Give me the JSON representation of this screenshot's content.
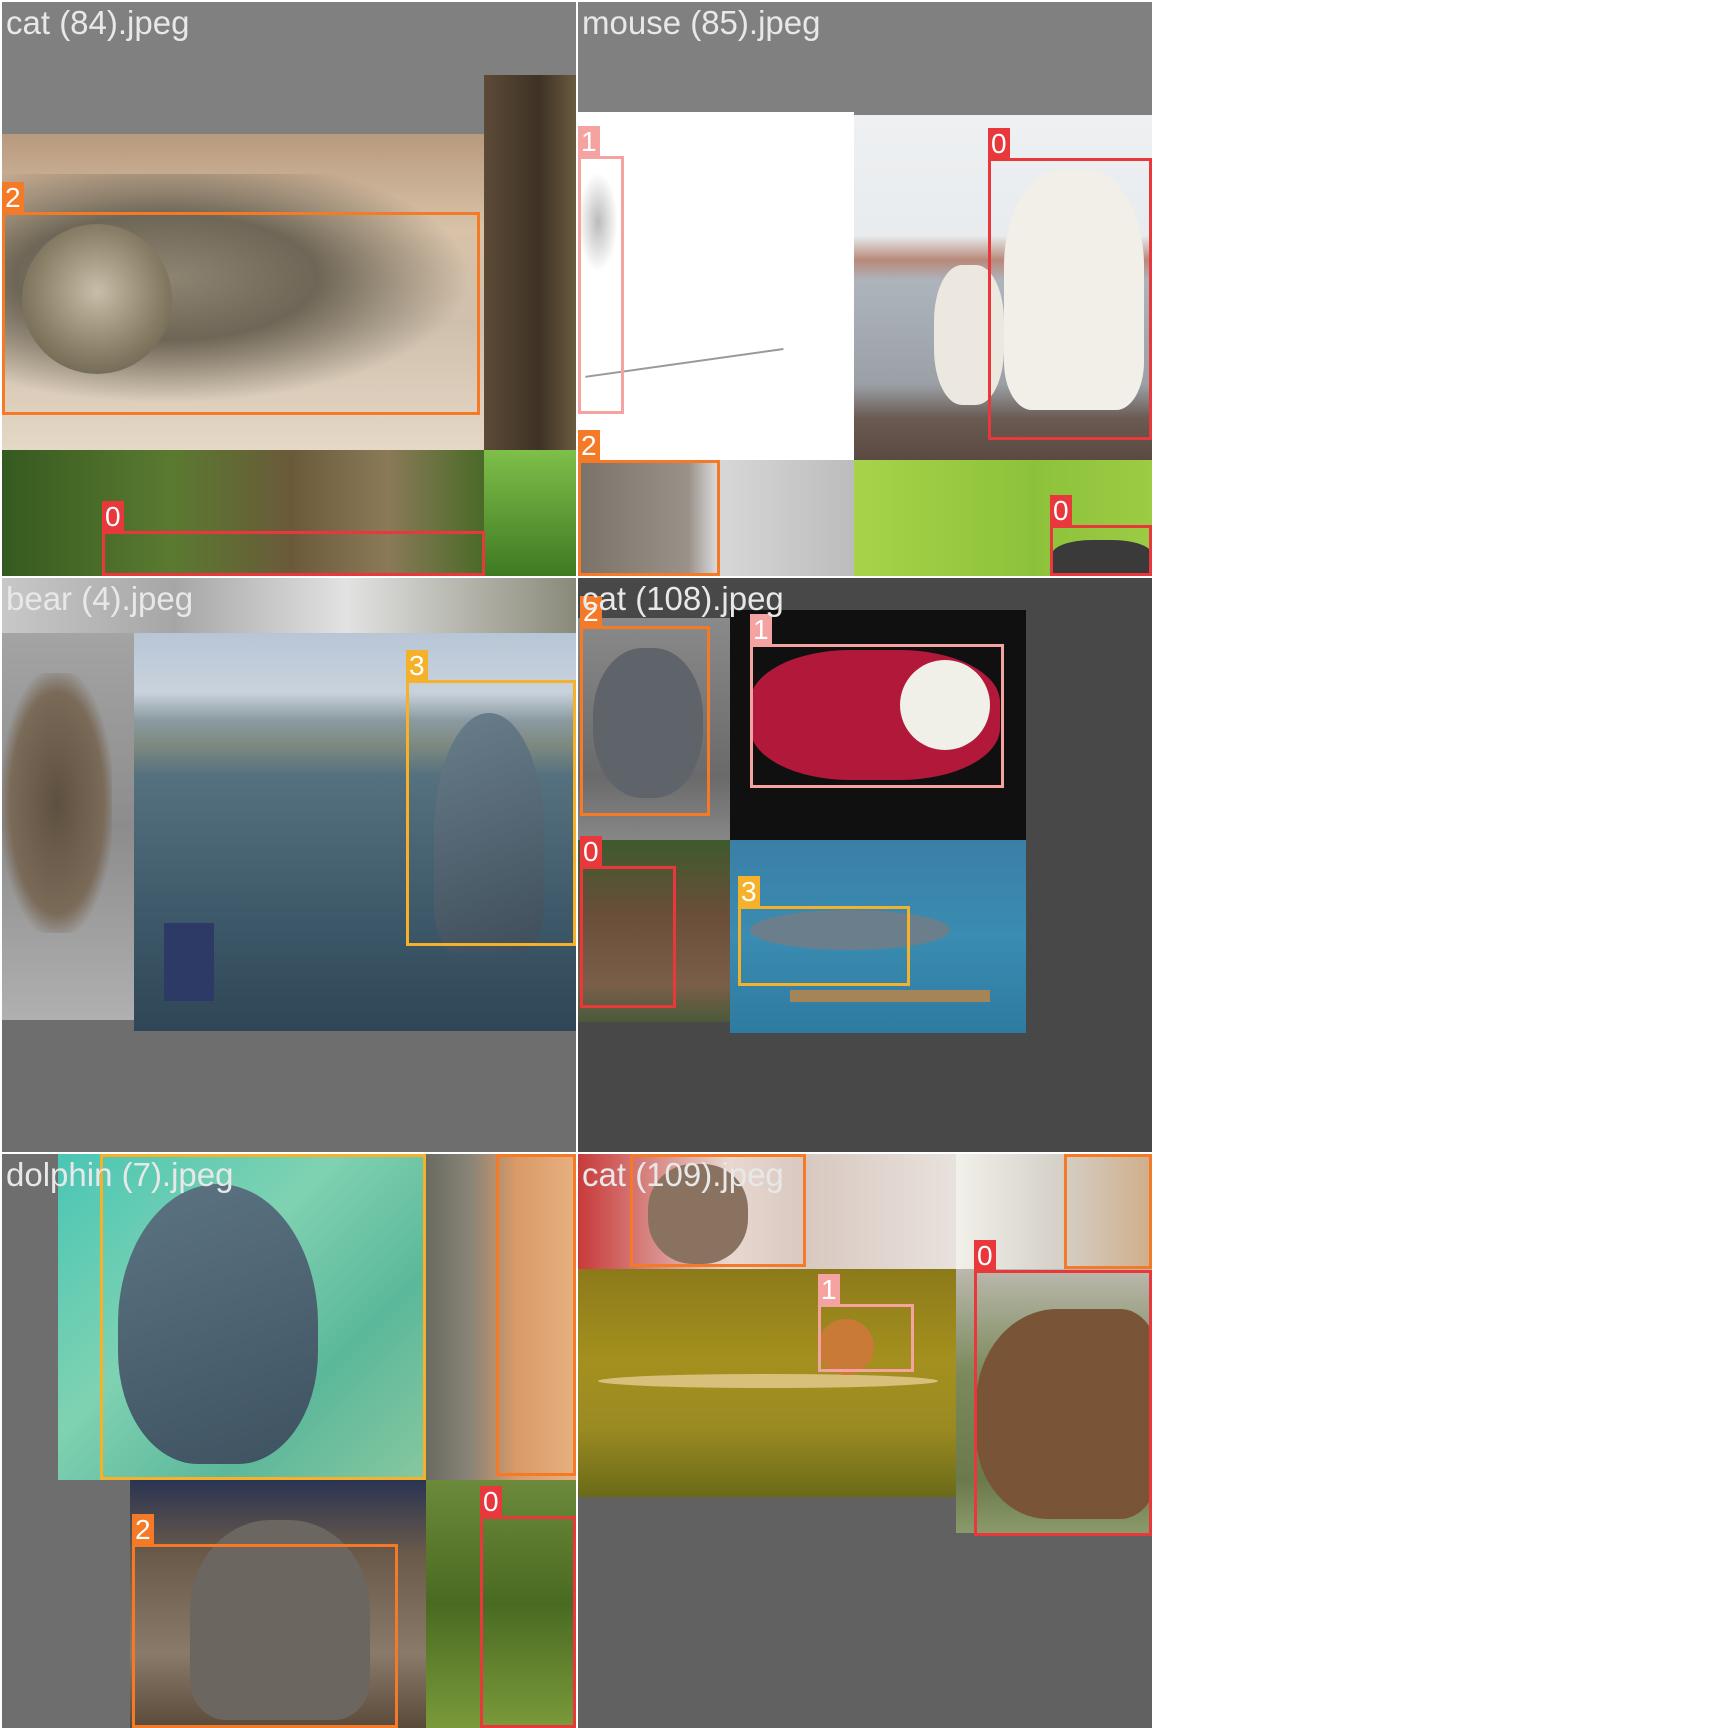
{
  "tiles": [
    {
      "title": "cat (84).jpeg"
    },
    {
      "title": "mouse (85).jpeg"
    },
    {
      "title": "bear (4).jpeg"
    },
    {
      "title": "cat (108).jpeg"
    },
    {
      "title": "dolphin (7).jpeg"
    },
    {
      "title": "cat (109).jpeg"
    }
  ],
  "class_colors": {
    "0": "#e8383c",
    "1": "#f5a3a0",
    "2": "#f57a28",
    "3": "#f5b12a"
  },
  "labels": {
    "c0": "0",
    "c1": "1",
    "c2": "2",
    "c3": "3"
  },
  "photo_subjects": [
    "cat lying down",
    "mouse sketch",
    "polar bears",
    "cat face close-up",
    "grass with bear",
    "forest with bear",
    "deer / mouse-deer",
    "jumping dolphin in bay",
    "grey cat",
    "lab mouse in sweater",
    "brown bear in grass",
    "dolphins underwater",
    "dolphin in aquarium",
    "orange cat",
    "cat in shark hat",
    "bear in grass",
    "kitten",
    "harvest mouse on wheat",
    "white/brown cat",
    "brown bear head"
  ]
}
